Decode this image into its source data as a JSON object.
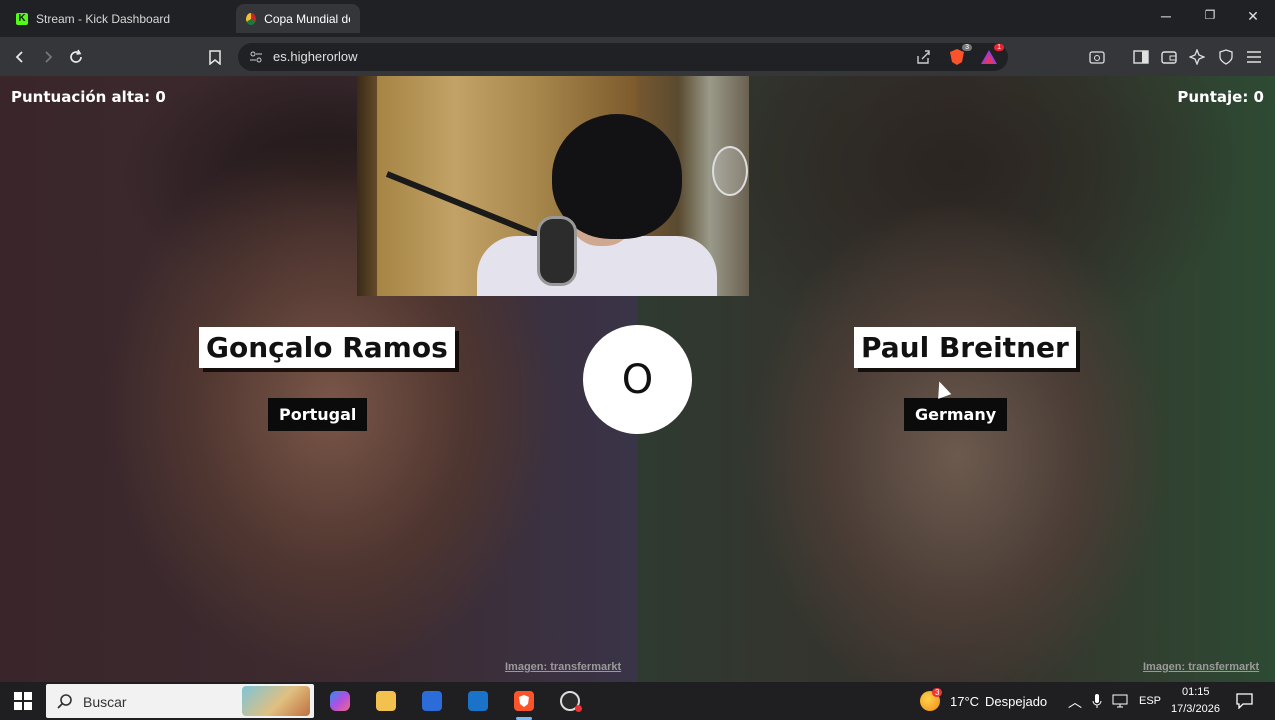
{
  "browser": {
    "tabs": [
      {
        "label": "Stream - Kick Dashboard",
        "favicon": "kick-icon",
        "active": false
      },
      {
        "label": "Copa Mundial de F",
        "favicon": "worldcup-icon",
        "active": true
      }
    ],
    "url": "es.higherorlow",
    "window_controls": {
      "minimize": "─",
      "restore": "❐",
      "close": "✕"
    },
    "extension_badges": {
      "shield": "3",
      "alert": "1"
    }
  },
  "game": {
    "high_score_label": "Puntuación alta: 0",
    "score_label": "Puntaje: 0",
    "vs_label": "O",
    "left": {
      "player": "Gonçalo Ramos",
      "country": "Portugal",
      "credit": "Imagen: transfermarkt"
    },
    "right": {
      "player": "Paul Breitner",
      "country": "Germany",
      "credit": "Imagen: transfermarkt"
    }
  },
  "taskbar": {
    "search_placeholder": "Buscar",
    "weather_badge": "3",
    "temperature": "17°C",
    "condition": "Despejado",
    "language": "ESP",
    "time": "01:15",
    "date": "17/3/2026"
  },
  "colors": {
    "kick_green": "#53fc18",
    "brave_orange": "#fb542b",
    "name_box": "#ffffff",
    "country_box": "#0b0b0b"
  }
}
